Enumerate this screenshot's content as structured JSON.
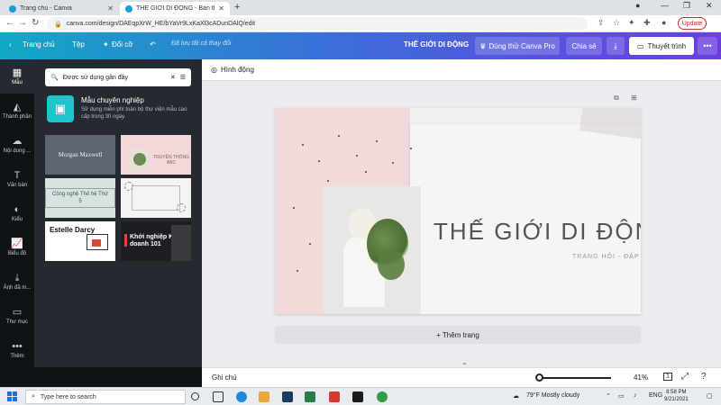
{
  "browser": {
    "tabs": [
      {
        "title": "Trang chủ - Canva"
      },
      {
        "title": "THẾ GIỚI DI ĐỘNG - Bản thuyết..."
      }
    ],
    "url": "canva.com/design/DAEqpXrW_HE/bYaVr9LxKaXl3cADunDAlQ/edit",
    "update_label": "Update"
  },
  "header": {
    "home": "Trang chủ",
    "file": "Tệp",
    "resize": "Đổi cỡ",
    "saved_status": "Đã lưu tất cả thay đổi",
    "doc_title": "THẾ GIỚI DI ĐỘNG",
    "pro_button": "Dùng thử Canva Pro",
    "share_button": "Chia sẻ",
    "present_button": "Thuyết trình"
  },
  "rail": {
    "items": [
      {
        "label": "Mẫu",
        "icon": "template-icon"
      },
      {
        "label": "Thành phần",
        "icon": "elements-icon"
      },
      {
        "label": "Nội dung ...",
        "icon": "cloud-upload-icon"
      },
      {
        "label": "Văn bản",
        "icon": "text-icon"
      },
      {
        "label": "Kiểu",
        "icon": "palette-icon"
      },
      {
        "label": "Biểu đồ",
        "icon": "chart-icon"
      },
      {
        "label": "Ảnh đã m...",
        "icon": "download-icon"
      },
      {
        "label": "Thư mục",
        "icon": "folder-icon"
      },
      {
        "label": "Thêm",
        "icon": "more-icon"
      }
    ]
  },
  "panel": {
    "search_value": "Được sử dụng gần đây",
    "promo_title": "Mẫu chuyên nghiệp",
    "promo_desc": "Sử dụng miễn phí toàn bộ thư viện mẫu cao cấp trong 30 ngày.",
    "templates": [
      {
        "text": "Morgan Maxwell"
      },
      {
        "text": "TRUYỀN THÔNG ABC"
      },
      {
        "text": "Công nghệ Thế hệ Thứ 5"
      },
      {
        "text": ""
      },
      {
        "text": "Estelle Darcy"
      },
      {
        "text": "Khởi nghiệp Kinh doanh 101"
      }
    ]
  },
  "canvas": {
    "toolbar_label": "Hình động",
    "slide_title": "THẾ GIỚI DI ĐỘNG",
    "slide_subtitle": "TRANG HỎI - ĐÁP",
    "add_page": "+ Thêm trang"
  },
  "status": {
    "notes": "Ghi chú",
    "zoom": "41%",
    "page_count": "1"
  },
  "taskbar": {
    "search_placeholder": "Type here to search",
    "weather": "79°F  Mostly cloudy",
    "lang": "ENG",
    "time": "8:58 PM",
    "date": "9/21/2021"
  }
}
